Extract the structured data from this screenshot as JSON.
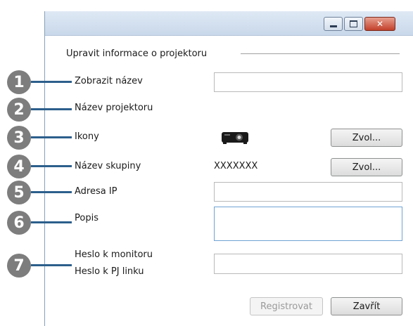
{
  "window": {
    "controls": {
      "minimize": "minimize-icon",
      "maximize": "maximize-icon",
      "close": "✕"
    }
  },
  "section_title": "Upravit informace o projektoru",
  "fields": {
    "display_name": {
      "label": "Zobrazit název",
      "value": ""
    },
    "projector_name": {
      "label": "Název projektoru"
    },
    "icons": {
      "label": "Ikony",
      "icon": "projector-icon",
      "button": "Zvol..."
    },
    "group_name": {
      "label": "Název skupiny",
      "value": "XXXXXXX",
      "button": "Zvol..."
    },
    "ip_address": {
      "label": "Adresa IP",
      "value": ""
    },
    "description": {
      "label": "Popis",
      "value": ""
    },
    "monitor_password": {
      "label": "Heslo k monitoru"
    },
    "pj_link_password": {
      "label": "Heslo k PJ linku",
      "value": ""
    }
  },
  "callouts": [
    "1",
    "2",
    "3",
    "4",
    "5",
    "6",
    "7"
  ],
  "buttons": {
    "register": "Registrovat",
    "close": "Zavřít"
  },
  "colors": {
    "callout": "#7d7d7d",
    "leader": "#2c5f8c",
    "close_button": "#c2402a"
  }
}
